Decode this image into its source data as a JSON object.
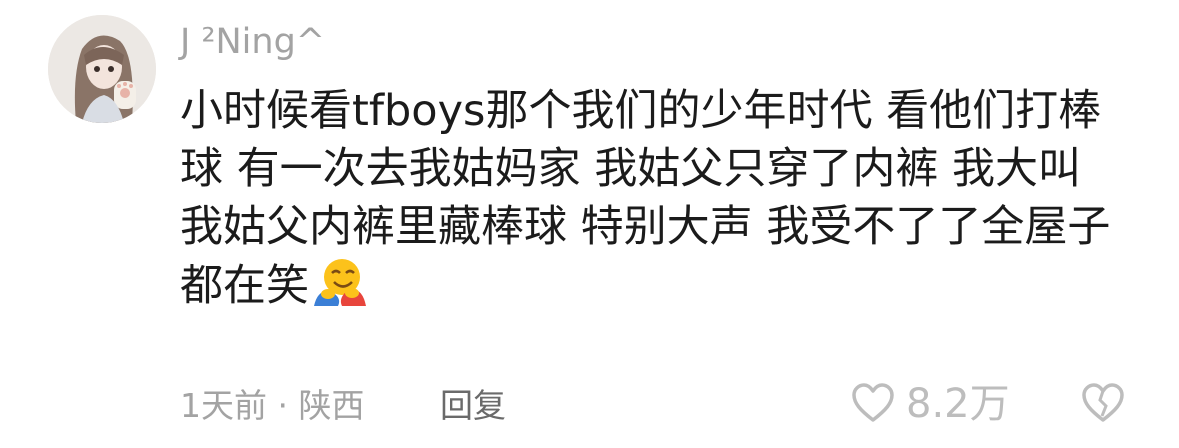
{
  "comment": {
    "username": "J ²Ning^",
    "content_lines": [
      "小时候看tfboys那个我们的少年时代 看他们打棒",
      "球 有一次去我姑妈家 我姑父只穿了内裤 我大叫",
      "我姑父内裤里藏棒球 特别大声 我受不了了全屋子",
      "都在笑"
    ],
    "emoji_icon": "hugging-face-emoji",
    "meta": "1天前 · 陕西",
    "reply_label": "回复",
    "like_icon": "heart-icon",
    "like_count": "8.2万",
    "dislike_icon": "broken-heart-icon"
  },
  "colors": {
    "primary_text": "#1b1b1b",
    "secondary_text": "#a3a3a3",
    "reply_text": "#6a6a6a"
  }
}
